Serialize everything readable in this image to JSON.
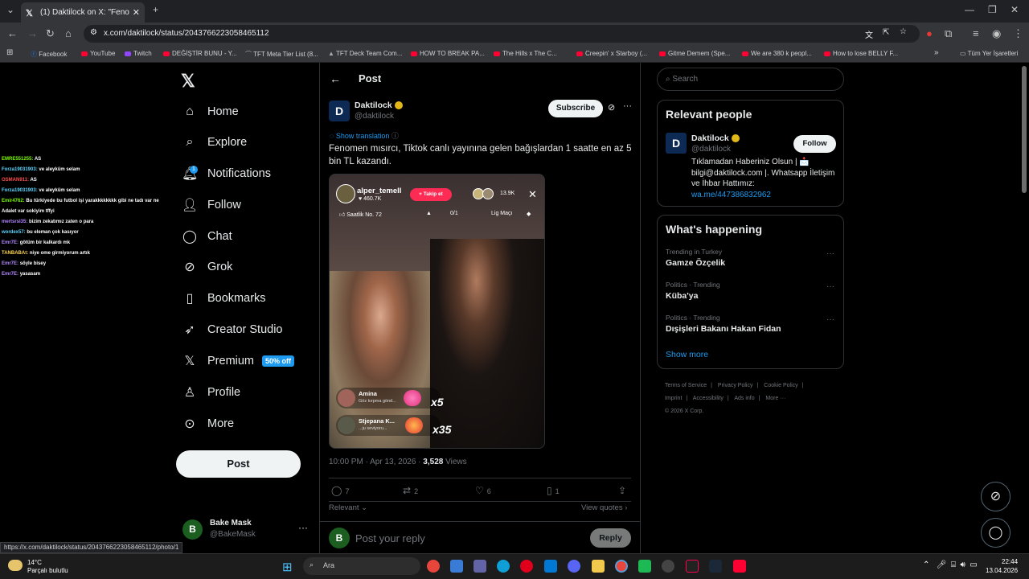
{
  "browser": {
    "tab_title": "(1) Daktilock on X: \"Fenomen m",
    "url": "x.com/daktilock/status/2043766223058465112",
    "bookmarks": [
      "Facebook",
      "YouTube",
      "Twitch",
      "DEĞİŞTİR BUNU - Y...",
      "TFT Meta Tier List (8...",
      "TFT Deck Team Com...",
      "HOW TO BREAK PA...",
      "The Hills x The C...",
      "Creepin' x Starboy (...",
      "Gitme Demem (Spe...",
      "We are 380 k peopl...",
      "How to lose BELLY F..."
    ],
    "all_bookmarks": "Tüm Yer İşaretleri",
    "status_url": "https://x.com/daktilock/status/2043766223058465112/photo/1"
  },
  "chat_overlay": [
    {
      "user": "EMRE551255:",
      "msg": "AS",
      "color": "#7cfc00"
    },
    {
      "user": "Forza19031903:",
      "msg": "ve aleyküm selam",
      "color": "#5cd6ff"
    },
    {
      "user": "OSMAN911:",
      "msg": "AS",
      "color": "#ff4d4d"
    },
    {
      "user": "Forza19031903:",
      "msg": "ve aleyküm selam",
      "color": "#5cd6ff"
    },
    {
      "user": "Emir4762:",
      "msg": "Bu türkiyede bu futbol işi yarakkkkkkkk gibi ne tadı var ne Adalet var sokiyim tffyi",
      "color": "#7cfc00"
    },
    {
      "user": "mertsrsl35:",
      "msg": "bizim zekatımız zaten o para",
      "color": "#b388ff"
    },
    {
      "user": "wordex57:",
      "msg": "bu eleman çok kasıyor",
      "color": "#5cd6ff"
    },
    {
      "user": "Emr7E:",
      "msg": "götüm bir kalkardı mk",
      "color": "#b388ff"
    },
    {
      "user": "TANBABAt:",
      "msg": "niye ome girmiyorum artık",
      "color": "#ffd54f"
    },
    {
      "user": "Emr7E:",
      "msg": "söyle bisey",
      "color": "#b388ff"
    },
    {
      "user": "Emr7E:",
      "msg": "yasasam",
      "color": "#b388ff"
    }
  ],
  "nav": {
    "home": "Home",
    "explore": "Explore",
    "notifications": "Notifications",
    "notif_count": "1",
    "follow": "Follow",
    "chat": "Chat",
    "grok": "Grok",
    "bookmarks": "Bookmarks",
    "creator_studio": "Creator Studio",
    "premium": "Premium",
    "premium_badge": "50% off",
    "profile": "Profile",
    "more": "More",
    "post_button": "Post"
  },
  "account": {
    "initial": "B",
    "name": "Bake Mask",
    "handle": "@BakeMask"
  },
  "post": {
    "header": "Post",
    "author_initial": "D",
    "author": "Daktilock",
    "handle": "@daktilock",
    "subscribe": "Subscribe",
    "show_translation": "Show translation",
    "text": "Fenomen mısırcı, Tiktok canlı yayınına gelen bağışlardan 1 saatte en az 5 bin TL kazandı.",
    "media": {
      "streamer": "alper_temell",
      "likes": "460.7K",
      "follow_pill": "+ Takip et",
      "viewers": "13.9K",
      "rank": "Saatlik No. 72",
      "progress": "0/1",
      "match": "Lig Maçı",
      "gift1_name": "Amina",
      "gift1_sub": "Göz kırpma gönd...",
      "gift1_count": "x5",
      "gift2_name": "Stjepana K...",
      "gift2_sub": "...ju seviyoru...",
      "gift2_count": "x35"
    },
    "time": "10:00 PM · Apr 13, 2026 · ",
    "views": "3,528",
    "views_label": " Views",
    "replies": "7",
    "reposts": "2",
    "likes": "6",
    "bookmarks": "1",
    "relevant": "Relevant",
    "view_quotes": "View quotes",
    "reply_initial": "B",
    "reply_placeholder": "Post your reply",
    "reply_button": "Reply"
  },
  "sidebar": {
    "search_placeholder": "Search",
    "relevant_title": "Relevant people",
    "rp_initial": "D",
    "rp_name": "Daktilock",
    "rp_handle": "@daktilock",
    "rp_follow": "Follow",
    "rp_bio": "Tıklamadan Haberiniz Olsun | 📩 bilgi@daktilock.com |. Whatsapp İletişim ve İhbar Hattımız: ",
    "rp_link": "wa.me/447386832962",
    "happening_title": "What's happening",
    "trends": [
      {
        "context": "Trending in Turkey",
        "name": "Gamze Özçelik"
      },
      {
        "context": "Politics · Trending",
        "name": "Küba'ya"
      },
      {
        "context": "Politics · Trending",
        "name": "Dışişleri Bakanı Hakan Fidan"
      }
    ],
    "show_more": "Show more",
    "footer": [
      "Terms of Service",
      "|",
      "Privacy Policy",
      "|",
      "Cookie Policy",
      "|",
      "Imprint",
      "|",
      "Accessibility",
      "|",
      "Ads info",
      "|",
      "More ···",
      "© 2026 X Corp."
    ]
  },
  "taskbar": {
    "temp": "14°C",
    "condition": "Parçalı bulutlu",
    "search": "Ara",
    "time": "22:44",
    "date": "13.04.2026"
  }
}
